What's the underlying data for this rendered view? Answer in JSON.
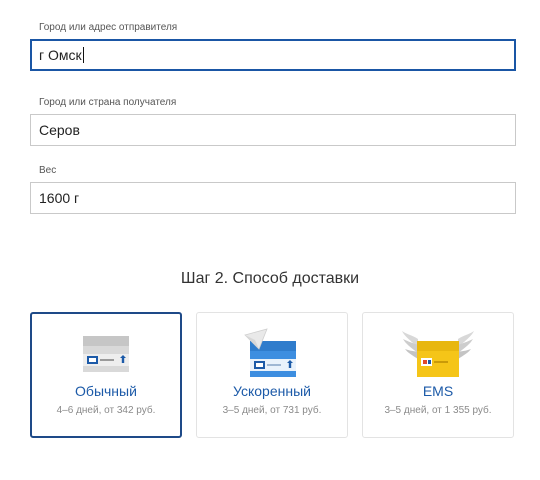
{
  "form": {
    "sender": {
      "label": "Город или адрес отправителя",
      "value": "г Омск"
    },
    "recipient": {
      "label": "Город или страна получателя",
      "value": "Серов"
    },
    "weight": {
      "label": "Вес",
      "value": "1600 г"
    }
  },
  "step2": {
    "title": "Шаг 2. Способ доставки",
    "options": [
      {
        "name": "Обычный",
        "details": "4–6 дней, от 342 руб.",
        "icon": "regular-parcel-icon",
        "selected": true
      },
      {
        "name": "Ускоренный",
        "details": "3–5 дней, от 731 руб.",
        "icon": "express-parcel-icon",
        "selected": false
      },
      {
        "name": "EMS",
        "details": "3–5 дней, от 1 355 руб.",
        "icon": "ems-parcel-icon",
        "selected": false
      }
    ]
  },
  "colors": {
    "accent": "#1c5aa8",
    "selected_border": "#1e4a88",
    "active_input_border": "#1a56a5",
    "express_blue": "#3d8ee0",
    "ems_yellow": "#f5c518"
  }
}
